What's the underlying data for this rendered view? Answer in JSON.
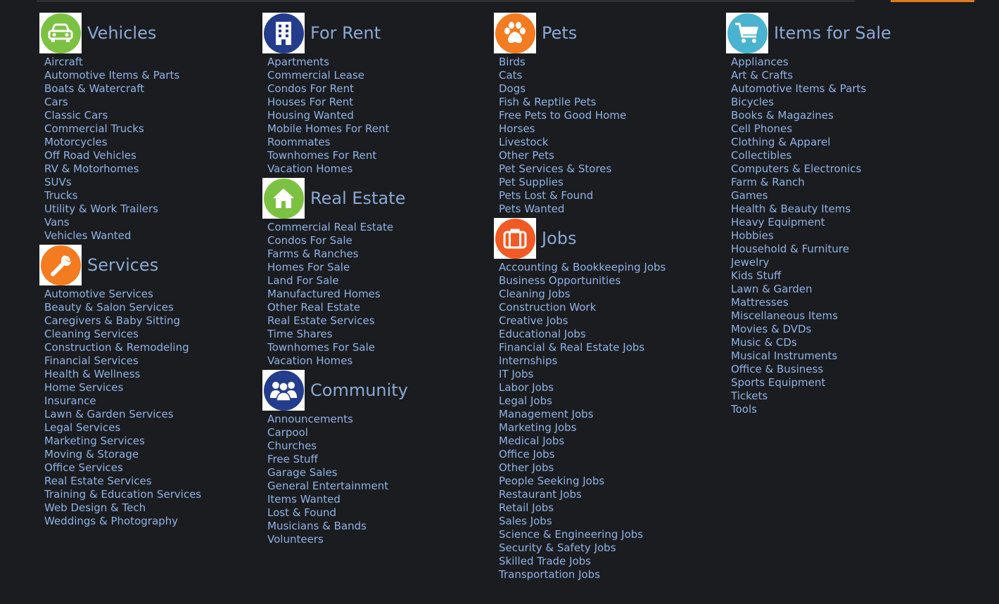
{
  "colors": {
    "background": "#1b1c1f",
    "link": "#8fb3e8",
    "heading": "#8aa9d6",
    "accent_bar": "#e07a1c",
    "vehicles_icon": "#7cc242",
    "for_rent_icon": "#233d8c",
    "pets_icon": "#f47b20",
    "items_icon": "#4ab3cf",
    "services_icon": "#f47b20",
    "real_estate_icon": "#7cc242",
    "jobs_icon": "#f15a24",
    "community_icon": "#233d8c"
  },
  "columns": [
    {
      "categories": [
        {
          "title": "Vehicles",
          "icon": "car-icon",
          "links": [
            "Aircraft",
            "Automotive Items & Parts",
            "Boats & Watercraft",
            "Cars",
            "Classic Cars",
            "Commercial Trucks",
            "Motorcycles",
            "Off Road Vehicles",
            "RV & Motorhomes",
            "SUVs",
            "Trucks",
            "Utility & Work Trailers",
            "Vans",
            "Vehicles Wanted"
          ]
        },
        {
          "title": "Services",
          "icon": "wrench-icon",
          "links": [
            "Automotive Services",
            "Beauty & Salon Services",
            "Caregivers & Baby Sitting",
            "Cleaning Services",
            "Construction & Remodeling",
            "Financial Services",
            "Health & Wellness",
            "Home Services",
            "Insurance",
            "Lawn & Garden Services",
            "Legal Services",
            "Marketing Services",
            "Moving & Storage",
            "Office Services",
            "Real Estate Services",
            "Training & Education Services",
            "Web Design & Tech",
            "Weddings & Photography"
          ]
        }
      ]
    },
    {
      "categories": [
        {
          "title": "For Rent",
          "icon": "building-icon",
          "links": [
            "Apartments",
            "Commercial Lease",
            "Condos For Rent",
            "Houses For Rent",
            "Housing Wanted",
            "Mobile Homes For Rent",
            "Roommates",
            "Townhomes For Rent",
            "Vacation Homes"
          ]
        },
        {
          "title": "Real Estate",
          "icon": "house-icon",
          "links": [
            "Commercial Real Estate",
            "Condos For Sale",
            "Farms & Ranches",
            "Homes For Sale",
            "Land For Sale",
            "Manufactured Homes",
            "Other Real Estate",
            "Real Estate Services",
            "Time Shares",
            "Townhomes For Sale",
            "Vacation Homes"
          ]
        },
        {
          "title": "Community",
          "icon": "people-icon",
          "links": [
            "Announcements",
            "Carpool",
            "Churches",
            "Free Stuff",
            "Garage Sales",
            "General Entertainment",
            "Items Wanted",
            "Lost & Found",
            "Musicians & Bands",
            "Volunteers"
          ]
        }
      ]
    },
    {
      "categories": [
        {
          "title": "Pets",
          "icon": "paw-icon",
          "links": [
            "Birds",
            "Cats",
            "Dogs",
            "Fish & Reptile Pets",
            "Free Pets to Good Home",
            "Horses",
            "Livestock",
            "Other Pets",
            "Pet Services & Stores",
            "Pet Supplies",
            "Pets Lost & Found",
            "Pets Wanted"
          ]
        },
        {
          "title": "Jobs",
          "icon": "briefcase-icon",
          "links": [
            "Accounting & Bookkeeping Jobs",
            "Business Opportunities",
            "Cleaning Jobs",
            "Construction Work",
            "Creative Jobs",
            "Educational Jobs",
            "Financial & Real Estate Jobs",
            "Internships",
            "IT Jobs",
            "Labor Jobs",
            "Legal Jobs",
            "Management Jobs",
            "Marketing Jobs",
            "Medical Jobs",
            "Office Jobs",
            "Other Jobs",
            "People Seeking Jobs",
            "Restaurant Jobs",
            "Retail Jobs",
            "Sales Jobs",
            "Science & Engineering Jobs",
            "Security & Safety Jobs",
            "Skilled Trade Jobs",
            "Transportation Jobs"
          ]
        }
      ]
    },
    {
      "categories": [
        {
          "title": "Items for Sale",
          "icon": "cart-icon",
          "links": [
            "Appliances",
            "Art & Crafts",
            "Automotive Items & Parts",
            "Bicycles",
            "Books & Magazines",
            "Cell Phones",
            "Clothing & Apparel",
            "Collectibles",
            "Computers & Electronics",
            "Farm & Ranch",
            "Games",
            "Health & Beauty Items",
            "Heavy Equipment",
            "Hobbies",
            "Household & Furniture",
            "Jewelry",
            "Kids Stuff",
            "Lawn & Garden",
            "Mattresses",
            "Miscellaneous Items",
            "Movies & DVDs",
            "Music & CDs",
            "Musical Instruments",
            "Office & Business",
            "Sports Equipment",
            "Tickets",
            "Tools"
          ]
        }
      ]
    }
  ]
}
